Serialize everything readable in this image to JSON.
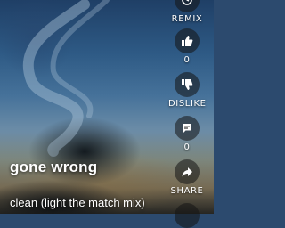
{
  "video": {
    "title": "gone wrong",
    "subtitle": "clean (light the match mix)"
  },
  "actions": {
    "remix": {
      "label": "REMIX",
      "icon": "remix-icon"
    },
    "like": {
      "count": "0",
      "icon": "thumbs-up-icon"
    },
    "dislike": {
      "label": "DISLIKE",
      "icon": "thumbs-down-icon"
    },
    "comment": {
      "count": "0",
      "icon": "comment-icon"
    },
    "share": {
      "label": "SHARE",
      "icon": "share-icon"
    }
  },
  "colors": {
    "text": "#ffffff",
    "button_bg": "#141414"
  }
}
